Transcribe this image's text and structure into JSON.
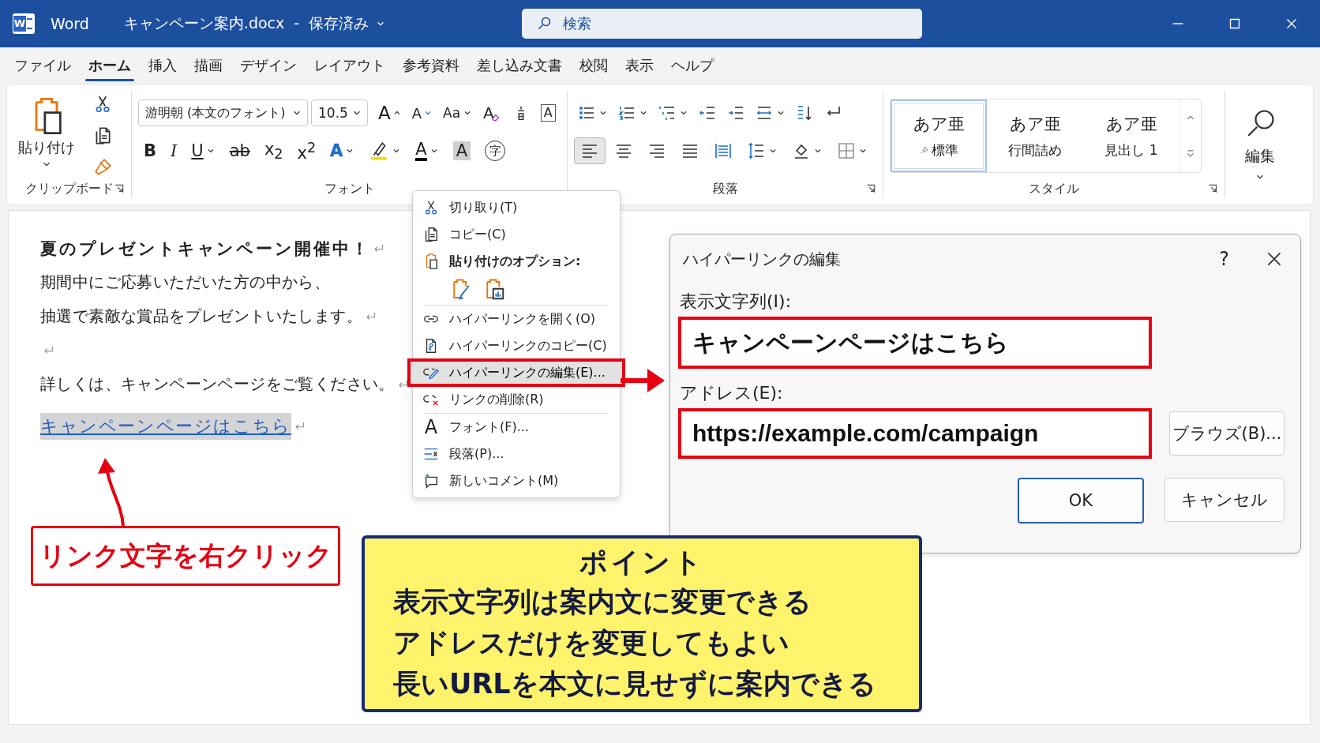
{
  "title_bar": {
    "logo_letter": "W",
    "app_name": "Word",
    "document_title": "キャンペーン案内.docx",
    "separator": "-",
    "save_status": "保存済み",
    "search_placeholder": "検索"
  },
  "menu_tabs": [
    {
      "label": "ファイル",
      "selected": false
    },
    {
      "label": "ホーム",
      "selected": true
    },
    {
      "label": "挿入",
      "selected": false
    },
    {
      "label": "描画",
      "selected": false
    },
    {
      "label": "デザイン",
      "selected": false
    },
    {
      "label": "レイアウト",
      "selected": false
    },
    {
      "label": "参考資料",
      "selected": false
    },
    {
      "label": "差し込み文書",
      "selected": false
    },
    {
      "label": "校閲",
      "selected": false
    },
    {
      "label": "表示",
      "selected": false
    },
    {
      "label": "ヘルプ",
      "selected": false
    }
  ],
  "ribbon": {
    "clipboard": {
      "paste_label": "貼り付け",
      "group_label": "クリップボード"
    },
    "font": {
      "font_name": "游明朝 (本文のフォント)",
      "font_size": "10.5",
      "group_label": "フォント",
      "row1": [
        {
          "kind": "grow",
          "label": "A",
          "dropdown": false
        },
        {
          "kind": "shrink",
          "label": "A",
          "dropdown": false
        },
        {
          "kind": "case",
          "label": "Aa",
          "dropdown": true
        },
        {
          "kind": "clear",
          "label": "A",
          "dropdown": false
        },
        {
          "kind": "phonetic",
          "dropdown": false
        },
        {
          "kind": "border",
          "label": "A",
          "dropdown": false
        }
      ],
      "row2": [
        {
          "kind": "bold",
          "label": "B",
          "dropdown": false
        },
        {
          "kind": "italic",
          "label": "I",
          "dropdown": false
        },
        {
          "kind": "underline",
          "label": "U",
          "dropdown": true
        },
        {
          "kind": "strike",
          "label": "ab",
          "dropdown": false
        },
        {
          "kind": "subscript",
          "label": "x$_{2}$",
          "dropdown": false
        },
        {
          "kind": "superscript",
          "label": "x$^{2}$",
          "dropdown": false
        },
        {
          "kind": "effects",
          "label": "A",
          "dropdown": true
        },
        {
          "kind": "highlight",
          "dropdown": true
        },
        {
          "kind": "fontcolor",
          "label": "A",
          "dropdown": true
        },
        {
          "kind": "shading",
          "label": "A",
          "dropdown": false
        },
        {
          "kind": "enclose",
          "label": "字",
          "dropdown": false
        }
      ]
    },
    "paragraph": {
      "group_label": "段落",
      "row1": [
        {
          "kind": "bullets",
          "dropdown": true
        },
        {
          "kind": "numbering",
          "dropdown": true
        },
        {
          "kind": "multilevel",
          "dropdown": true
        },
        {
          "kind": "outdent",
          "dropdown": false
        },
        {
          "kind": "indent",
          "dropdown": false
        },
        {
          "kind": "asian",
          "dropdown": true
        },
        {
          "kind": "sort",
          "dropdown": false
        },
        {
          "kind": "marks",
          "dropdown": false
        }
      ],
      "row2": [
        {
          "kind": "alignleft",
          "selected": true,
          "dropdown": false
        },
        {
          "kind": "aligncenter",
          "selected": false,
          "dropdown": false
        },
        {
          "kind": "alignright",
          "selected": false,
          "dropdown": false
        },
        {
          "kind": "justify",
          "selected": false,
          "dropdown": false
        },
        {
          "kind": "distributed",
          "selected": false,
          "dropdown": false
        },
        {
          "kind": "linespacing",
          "selected": false,
          "dropdown": true
        },
        {
          "kind": "bucket",
          "selected": false,
          "dropdown": true
        },
        {
          "kind": "borders",
          "selected": false,
          "dropdown": true
        }
      ]
    },
    "styles": {
      "group_label": "スタイル",
      "items": [
        {
          "preview": "あア亜",
          "name": "標準",
          "selected": true
        },
        {
          "preview": "あア亜",
          "name": "行間詰め",
          "selected": false
        },
        {
          "preview": "あア亜",
          "name": "見出し 1",
          "selected": false
        }
      ]
    },
    "editing": {
      "label": "編集"
    }
  },
  "document": {
    "paragraphs": [
      {
        "kind": "heading",
        "text": "夏のプレゼントキャンペーン開催中！",
        "paragraph_mark": true
      },
      {
        "kind": "body",
        "text": "期間中にご応募いただいた方の中から、",
        "paragraph_mark": false
      },
      {
        "kind": "body",
        "text": "抽選で素敵な賞品をプレゼントいたします。",
        "paragraph_mark": true
      },
      {
        "kind": "empty",
        "paragraph_mark": true
      },
      {
        "kind": "body",
        "text": "詳しくは、キャンペーンページをご覧ください。",
        "paragraph_mark": true
      },
      {
        "kind": "link",
        "text": "キャンペーンページはこちら",
        "paragraph_mark": true,
        "selected": true
      }
    ]
  },
  "context_menu": {
    "sections": [
      [
        {
          "kind": "cut",
          "label": "切り取り(T)",
          "highlighted": false
        },
        {
          "kind": "copy",
          "label": "コピー(C)",
          "highlighted": false
        },
        {
          "kind": "pasteheader",
          "label": "貼り付けのオプション:",
          "highlighted": false
        },
        {
          "kind": "pasteoptions"
        }
      ],
      [
        {
          "kind": "openlink",
          "label": "ハイパーリンクを開く(O)",
          "highlighted": false
        },
        {
          "kind": "copylink",
          "label": "ハイパーリンクのコピー(C)",
          "highlighted": false
        },
        {
          "kind": "editlink",
          "label": "ハイパーリンクの編集(E)...",
          "highlighted": true
        },
        {
          "kind": "removelink",
          "label": "リンクの削除(R)",
          "highlighted": false
        }
      ],
      [
        {
          "kind": "font",
          "label": "フォント(F)...",
          "icon_text": "A",
          "highlighted": false
        },
        {
          "kind": "paragraph",
          "label": "段落(P)...",
          "highlighted": false
        },
        {
          "kind": "comment",
          "label": "新しいコメント(M)",
          "highlighted": false
        }
      ]
    ]
  },
  "hyperlink_dialog": {
    "title": "ハイパーリンクの編集",
    "help": "?",
    "display_text_label": "表示文字列(I):",
    "display_text": "キャンペーンページはこちら",
    "display_text_highlighted": true,
    "address_label": "アドレス(E):",
    "address": "https://example.com/campaign",
    "address_highlighted": true,
    "browse_button": "ブラウズ(B)...",
    "ok_button": "OK",
    "cancel_button": "キャンセル"
  },
  "annotations": {
    "callout": "リンク文字を右クリック",
    "point": {
      "title": "ポイント",
      "lines": [
        "表示文字列は案内文に変更できる",
        "アドレスだけを変更してもよい",
        "長いURLを本文に見せずに案内できる"
      ]
    }
  }
}
